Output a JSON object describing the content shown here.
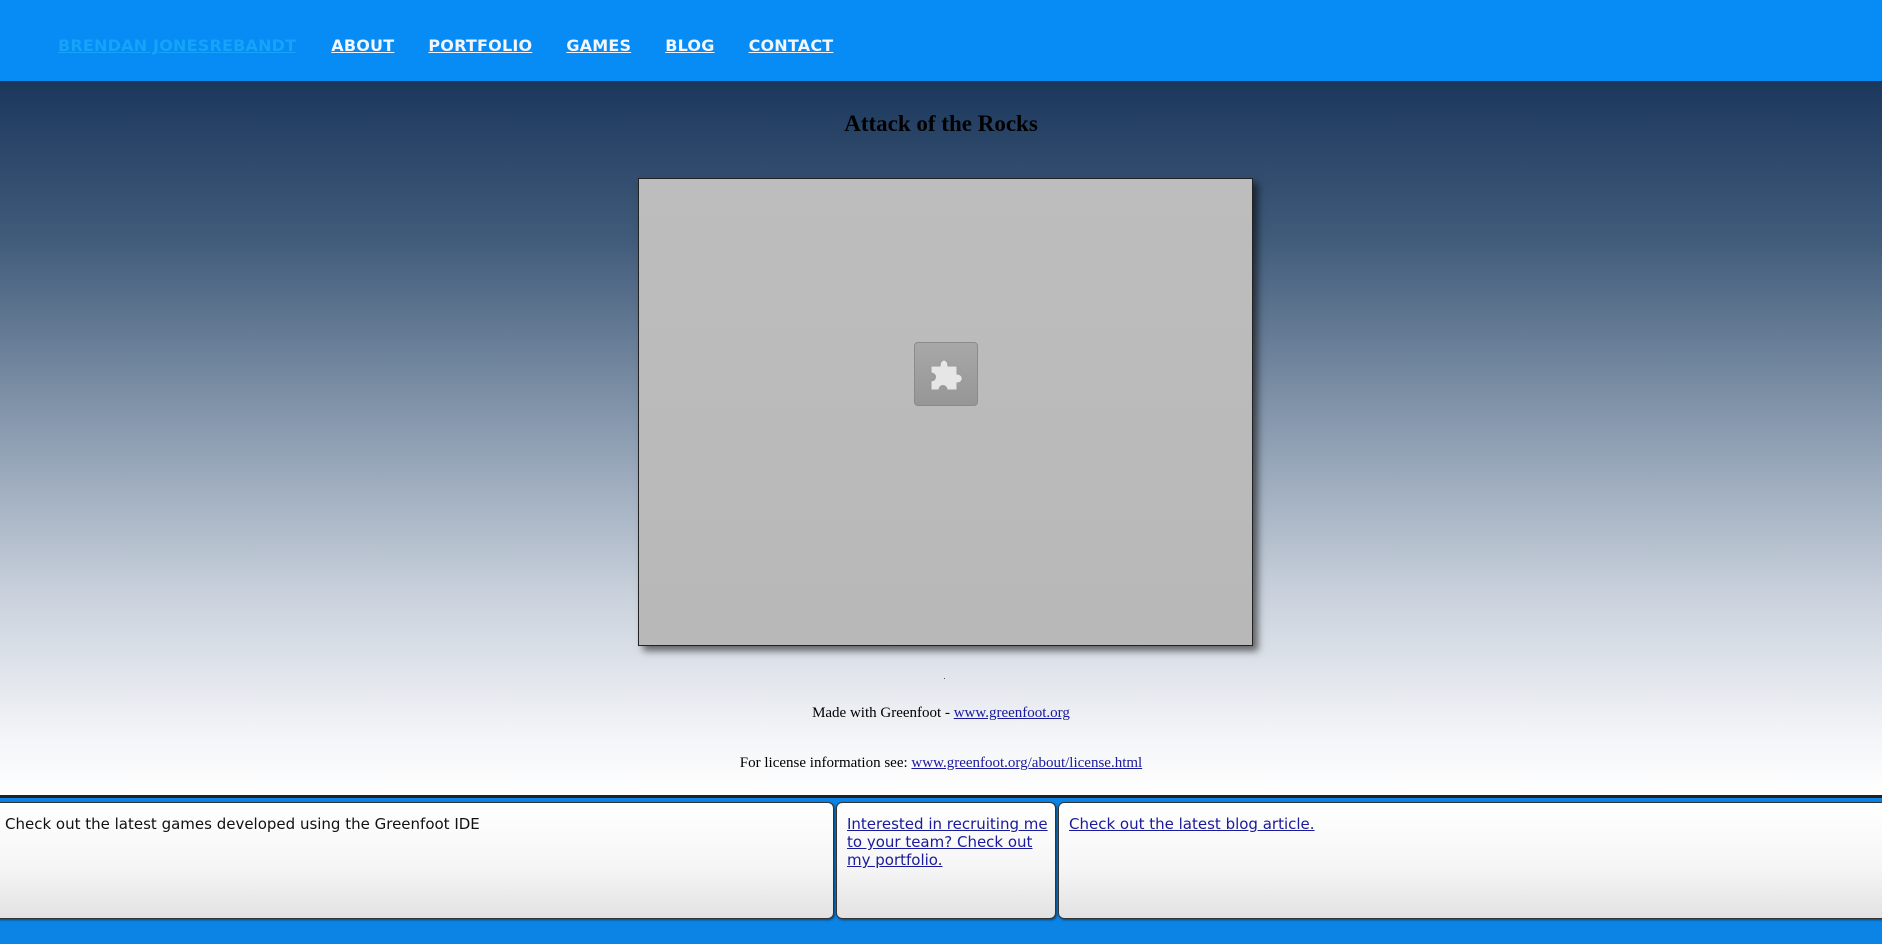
{
  "nav": {
    "brand": "BRENDAN JONESREBANDT",
    "items": [
      "ABOUT",
      "PORTFOLIO",
      "GAMES",
      "BLOG",
      "CONTACT"
    ]
  },
  "page": {
    "title": "Attack of the Rocks"
  },
  "applet": {
    "icon": "puzzle-piece-icon"
  },
  "credits": {
    "made_text": "Made with Greenfoot - ",
    "made_link": "www.greenfoot.org",
    "license_text": "For license information see: ",
    "license_link": "www.greenfoot.org/about/license.html"
  },
  "footer": {
    "panel1": "Check out the latest games developed using the Greenfoot IDE",
    "panel2": "Interested in recruiting me to your team? Check out my portfolio.",
    "panel3": "Check out the latest blog article."
  },
  "colors": {
    "header_bg": "#078bf4",
    "brand": "#15a4f9",
    "nav_link": "#f2f5fb",
    "link": "#1a1a9c"
  }
}
